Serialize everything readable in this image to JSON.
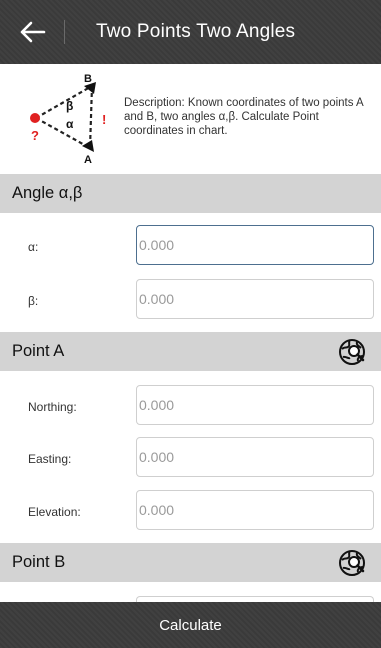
{
  "header": {
    "title": "Two Points Two Angles",
    "back_icon": "arrow-left-icon"
  },
  "description": {
    "text": "Description: Known coordinates of two points A and B, two angles α,β. Calculate Point coordinates in chart.",
    "diagram_labels": {
      "b": "B",
      "a": "A",
      "beta": "β",
      "alpha": "α",
      "unknown": "?",
      "arrow": "!"
    }
  },
  "sections": {
    "angle": {
      "title": "Angle α,β",
      "fields": [
        {
          "label": "α:",
          "placeholder": "0.000"
        },
        {
          "label": "β:",
          "placeholder": "0.000"
        }
      ]
    },
    "point_a": {
      "title": "Point A",
      "icon": "globe-search-icon",
      "fields": [
        {
          "label": "Northing:",
          "placeholder": "0.000"
        },
        {
          "label": "Easting:",
          "placeholder": "0.000"
        },
        {
          "label": "Elevation:",
          "placeholder": "0.000"
        }
      ]
    },
    "point_b": {
      "title": "Point B",
      "icon": "globe-search-icon"
    }
  },
  "actions": {
    "calculate": "Calculate"
  },
  "colors": {
    "header_bg": "#3c3c3c",
    "section_bg": "#d3d3d3",
    "focus_border": "#4d6f8f",
    "unknown_point": "#e02020"
  }
}
